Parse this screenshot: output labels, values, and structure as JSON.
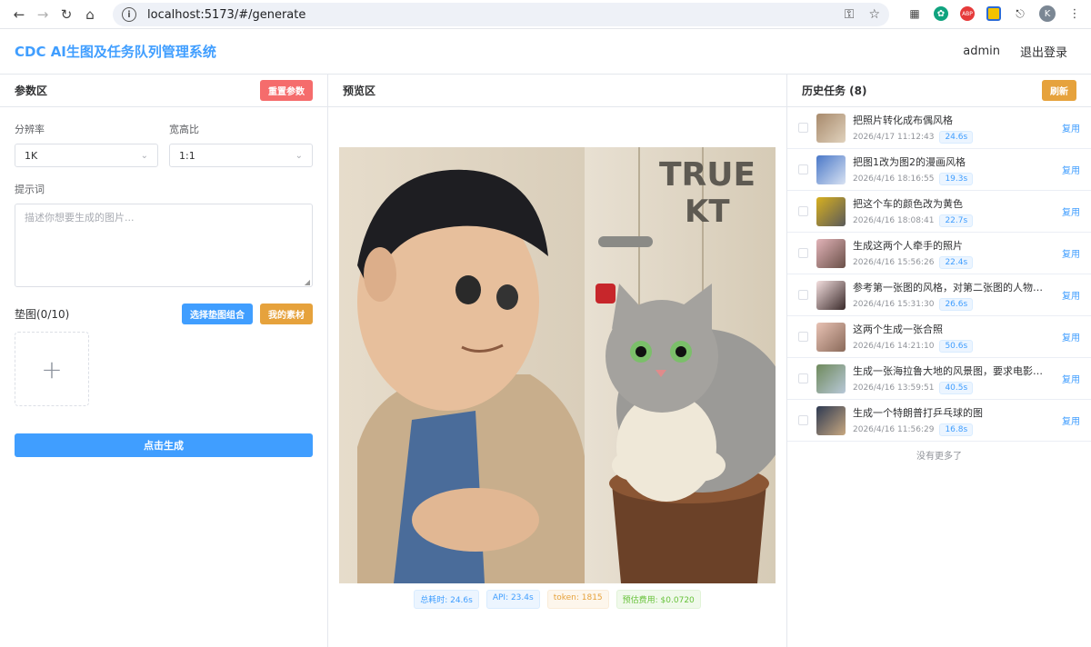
{
  "browser": {
    "url": "localhost:5173/#/generate",
    "profile_initial": "K",
    "ext_abp": "ABP"
  },
  "header": {
    "title": "CDC AI生图及任务队列管理系统",
    "user": "admin",
    "logout": "退出登录"
  },
  "params": {
    "title": "参数区",
    "reset": "重置参数",
    "resolution_label": "分辨率",
    "resolution_value": "1K",
    "ratio_label": "宽高比",
    "ratio_value": "1:1",
    "prompt_label": "提示词",
    "prompt_placeholder": "描述你想要生成的图片...",
    "pad_label": "垫图(0/10)",
    "select_pad": "选择垫图组合",
    "my_assets": "我的素材",
    "generate": "点击生成"
  },
  "preview": {
    "title": "预览区",
    "door_text_1": "TRUE",
    "door_text_2": "KT",
    "total_time": "总耗时: 24.6s",
    "api_time": "API: 23.4s",
    "tokens": "token: 1815",
    "cost": "预估费用: $0.0720"
  },
  "history": {
    "title": "历史任务 (8)",
    "refresh": "刷新",
    "reuse_label": "复用",
    "no_more": "没有更多了",
    "items": [
      {
        "title": "把照片转化成布偶风格",
        "time": "2026/4/17 11:12:43",
        "dur": "24.6s",
        "c1": "#a88a6c",
        "c2": "#e0d2bd"
      },
      {
        "title": "把图1改为图2的漫画风格",
        "time": "2026/4/16 18:16:55",
        "dur": "19.3s",
        "c1": "#4a78c8",
        "c2": "#d8e2f2"
      },
      {
        "title": "把这个车的颜色改为黄色",
        "time": "2026/4/16 18:08:41",
        "dur": "22.7s",
        "c1": "#d8b020",
        "c2": "#5a5a5a"
      },
      {
        "title": "生成这两个人牵手的照片",
        "time": "2026/4/16 15:56:26",
        "dur": "22.4s",
        "c1": "#e2b3b8",
        "c2": "#6a5048"
      },
      {
        "title": "参考第一张图的风格，对第二张图的人物进行修改",
        "time": "2026/4/16 15:31:30",
        "dur": "26.6s",
        "c1": "#f3dede",
        "c2": "#3a2a2a"
      },
      {
        "title": "这两个生成一张合照",
        "time": "2026/4/16 14:21:10",
        "dur": "50.6s",
        "c1": "#e8c2b4",
        "c2": "#8a6a5a"
      },
      {
        "title": "生成一张海拉鲁大地的风景图，要求电影风格的画面",
        "time": "2026/4/16 13:59:51",
        "dur": "40.5s",
        "c1": "#6f8a5c",
        "c2": "#b8c8d8"
      },
      {
        "title": "生成一个特朗普打乒乓球的图",
        "time": "2026/4/16 11:56:29",
        "dur": "16.8s",
        "c1": "#2e3a52",
        "c2": "#c8a880"
      }
    ]
  }
}
